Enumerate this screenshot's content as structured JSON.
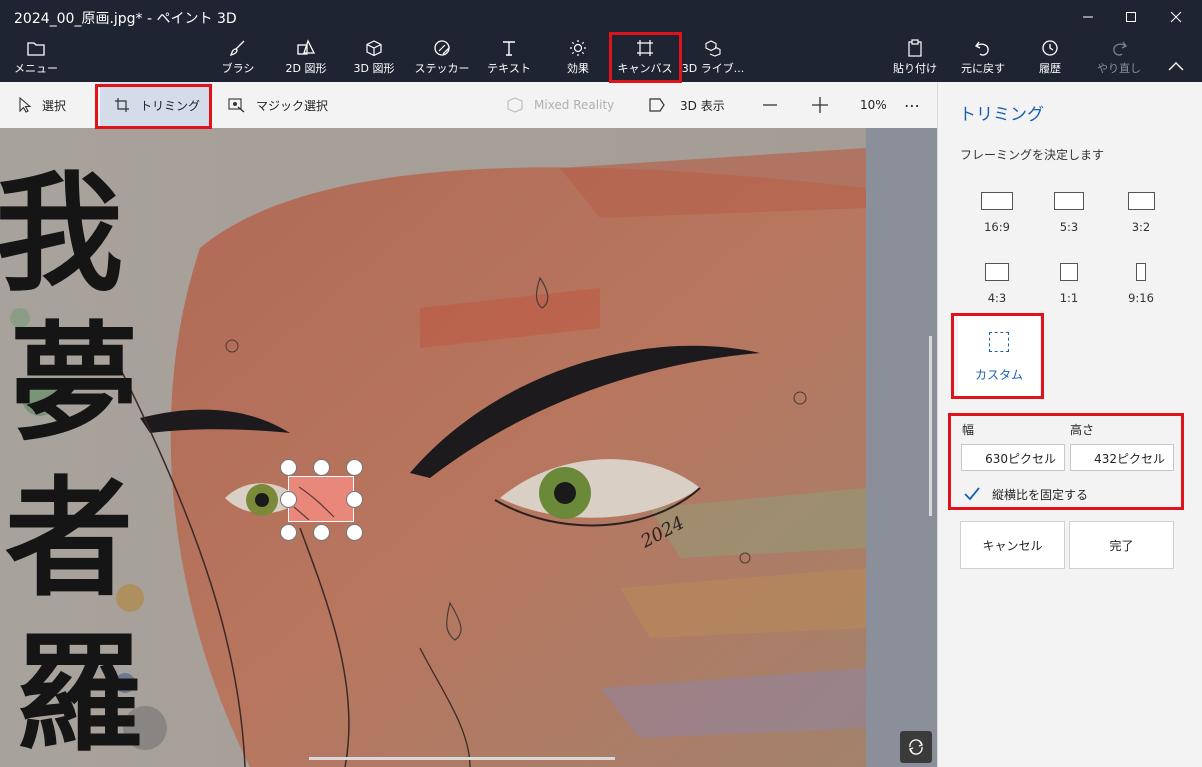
{
  "window": {
    "title": "2024_00_原画.jpg* - ペイント 3D"
  },
  "ribbon": {
    "menu": "メニュー",
    "brush": "ブラシ",
    "shapes2d": "2D 図形",
    "shapes3d": "3D 図形",
    "stickers": "ステッカー",
    "text": "テキスト",
    "effects": "効果",
    "canvas": "キャンバス",
    "library3d": "3D ライブ...",
    "paste": "貼り付け",
    "undo": "元に戻す",
    "history": "履歴",
    "redo": "やり直し"
  },
  "toolbar": {
    "select": "選択",
    "crop": "トリミング",
    "magic_select": "マジック選択",
    "mixed_reality": "Mixed Reality",
    "view3d": "3D 表示",
    "zoom": "10%",
    "more": "⋯"
  },
  "panel": {
    "title": "トリミング",
    "subtitle": "フレーミングを決定します",
    "ratios": [
      "16:9",
      "5:3",
      "3:2",
      "4:3",
      "1:1",
      "9:16"
    ],
    "custom": "カスタム",
    "width_label": "幅",
    "height_label": "高さ",
    "width_value": "630ピクセル",
    "height_value": "432ピクセル",
    "lock_aspect": "縦横比を固定する",
    "cancel": "キャンセル",
    "done": "完了"
  },
  "artwork": {
    "kanji": [
      "我",
      "夢",
      "者",
      "羅"
    ],
    "year": "2024"
  },
  "colors": {
    "accent": "#1b5fb4",
    "highlight": "#e0121b",
    "titlebar": "#1f2433"
  }
}
